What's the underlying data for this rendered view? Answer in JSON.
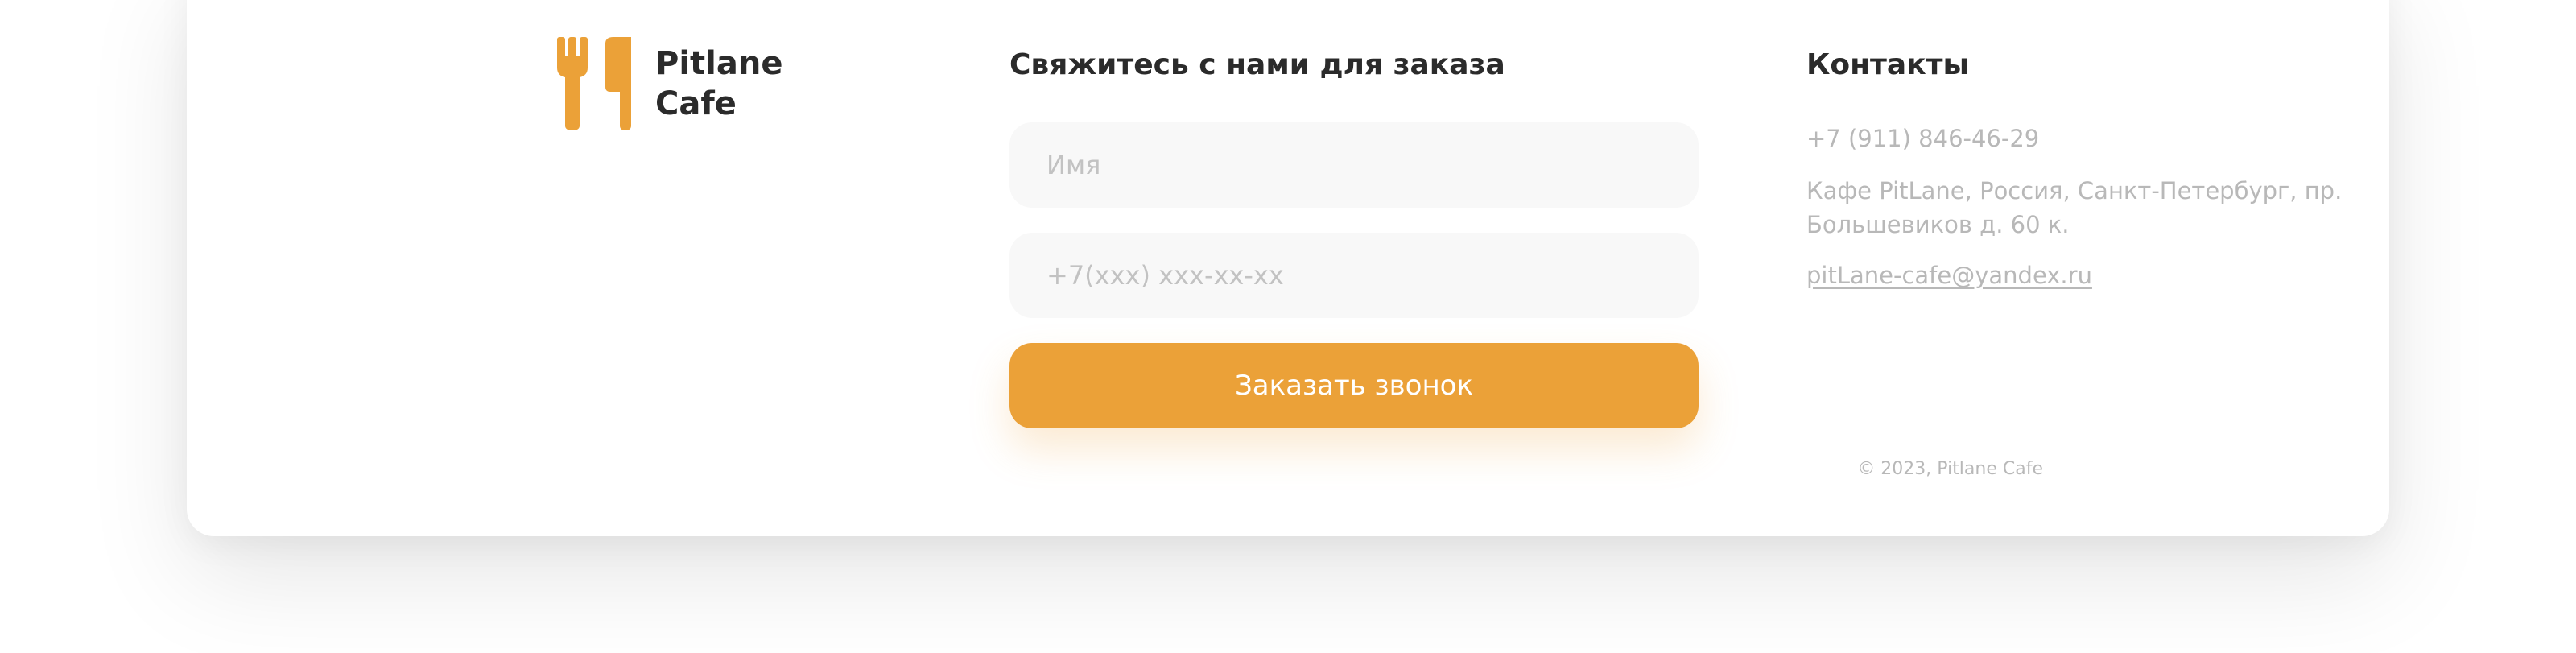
{
  "brand": {
    "name_line1": "Pitlane",
    "name_line2": "Cafe",
    "logo_icon": "fork-knife-icon",
    "accent_color": "#eba138"
  },
  "order_form": {
    "title": "Свяжитесь с нами для заказа",
    "name_placeholder": "Имя",
    "phone_placeholder": "+7(xxx) xxx-xx-xx",
    "submit_label": "Заказать звонок"
  },
  "contacts": {
    "title": "Контакты",
    "phone": "+7 (911) 846-46-29",
    "address": "Кафе PitLane, Россия, Санкт-Петербург, пр. Большевиков д. 60 к.",
    "email": "pitLane-cafe@yandex.ru"
  },
  "footer": {
    "copyright": "© 2023, Pitlane Cafe"
  }
}
